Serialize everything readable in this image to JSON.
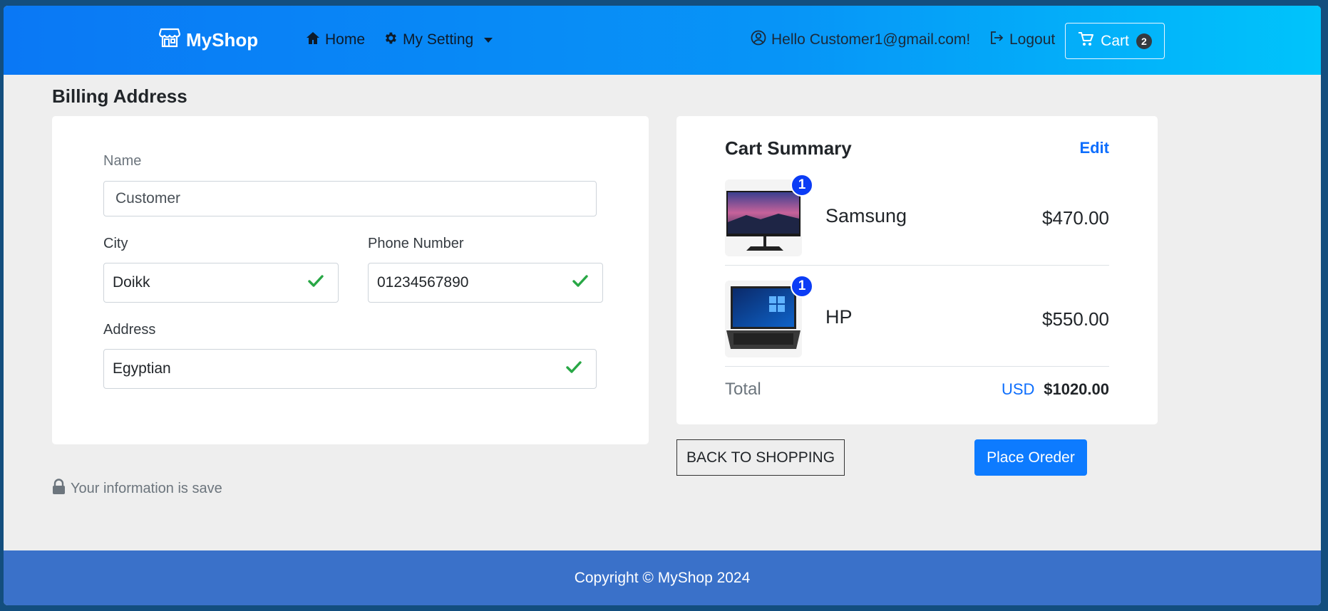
{
  "navbar": {
    "brand": "MyShop",
    "home_label": "Home",
    "setting_label": "My Setting",
    "greeting": "Hello Customer1@gmail.com!",
    "logout_label": "Logout",
    "cart_label": "Cart",
    "cart_count": "2"
  },
  "billing": {
    "title": "Billing Address",
    "name_label": "Name",
    "name_placeholder": "Customer",
    "city_label": "City",
    "city_value": "Doikk",
    "phone_label": "Phone Number",
    "phone_value": "01234567890",
    "address_label": "Address",
    "address_value": "Egyptian",
    "secure_note": "Your information is save"
  },
  "summary": {
    "title": "Cart Summary",
    "edit_label": "Edit",
    "items": [
      {
        "name": "Samsung",
        "price": "$470.00",
        "qty": "1"
      },
      {
        "name": "HP",
        "price": "$550.00",
        "qty": "1"
      }
    ],
    "total_label": "Total",
    "currency": "USD",
    "total_value": "$1020.00"
  },
  "actions": {
    "back_label": "BACK TO SHOPPING",
    "place_label": "Place Oreder"
  },
  "footer": {
    "copyright": "Copyright © MyShop 2024"
  },
  "colors": {
    "primary": "#0d6efd",
    "success": "#28a745",
    "footer": "#3a71c9"
  }
}
